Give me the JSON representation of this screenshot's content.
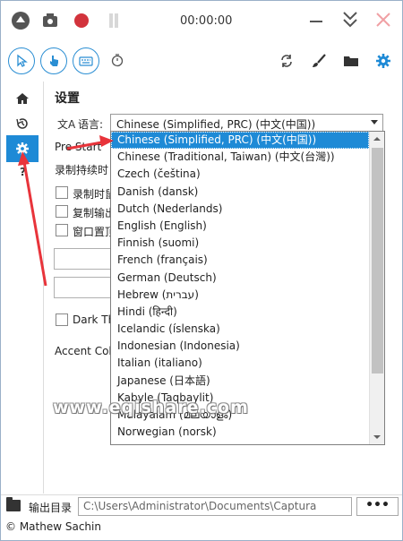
{
  "titlebar": {
    "timer": "00:00:00"
  },
  "settings": {
    "title": "设置",
    "language_label": "语言:",
    "language_icon": "文A",
    "language_selected": "Chinese (Simplified, PRC) (中文(中国))",
    "pre_start_label": "Pre Start",
    "record_duration_label": "录制持续时",
    "checkbox1": "录制时鼠",
    "checkbox2": "复制输出",
    "checkbox3": "窗口置顶",
    "dark_theme": "Dark Th",
    "accent_color": "Accent Col"
  },
  "dropdown": {
    "items": [
      "Chinese (Simplified, PRC) (中文(中国))",
      "Chinese (Traditional, Taiwan) (中文(台灣))",
      "Czech (čeština)",
      "Danish (dansk)",
      "Dutch (Nederlands)",
      "English (English)",
      "Finnish (suomi)",
      "French (français)",
      "German (Deutsch)",
      "Hebrew (עברית)",
      "Hindi (हिन्दी)",
      "Icelandic (íslenska)",
      "Indonesian (Indonesia)",
      "Italian (italiano)",
      "Japanese (日本語)",
      "Kabyle (Taqbaylit)",
      "Malayalam (മലയാളം)",
      "Norwegian (norsk)"
    ]
  },
  "bottombar": {
    "output_label": "输出目录",
    "output_path": "C:\\Users\\Administrator\\Documents\\Captura",
    "more_button": "•••"
  },
  "footer": "© Mathew Sachin",
  "watermark": "www.eqishare.com",
  "colors": {
    "accent": "#1e8ad6",
    "record": "#d2333c",
    "annotation": "#e8343b"
  }
}
